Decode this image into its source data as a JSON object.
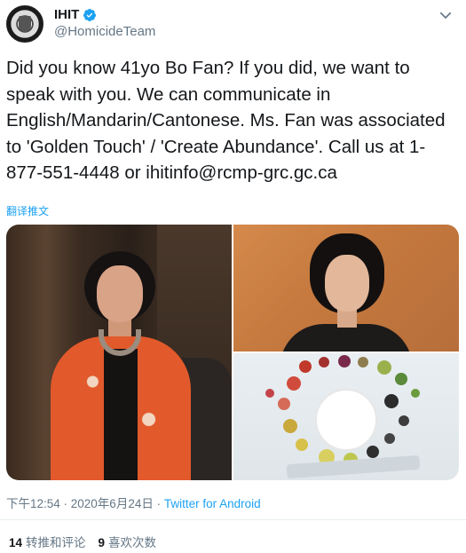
{
  "author": {
    "display_name": "IHIT",
    "handle": "@HomicideTeam",
    "verified": true
  },
  "icons": {
    "avatar": "police-crest-avatar",
    "verified": "verified-badge-icon",
    "menu": "chevron-down-icon"
  },
  "tweet": {
    "text": "Did you know 41yo Bo Fan? If you did, we want to speak with you. We can communicate in English/Mandarin/Cantonese. Ms. Fan was associated to 'Golden Touch' / 'Create Abundance'. Call us at 1-877-551-4448 or ihitinfo@rcmp-grc.gc.ca",
    "translate_label": "翻译推文"
  },
  "meta": {
    "timestamp": "下午12:54 · 2020年6月24日 · ",
    "source": "Twitter for Android"
  },
  "stats": {
    "retweets_count": "14",
    "retweets_label": "转推和评论",
    "likes_count": "9",
    "likes_label": "喜欢次数"
  },
  "colors": {
    "link_blue": "#1da1f2",
    "text": "#14171a",
    "muted": "#657786",
    "divider": "#e6ecf0"
  }
}
